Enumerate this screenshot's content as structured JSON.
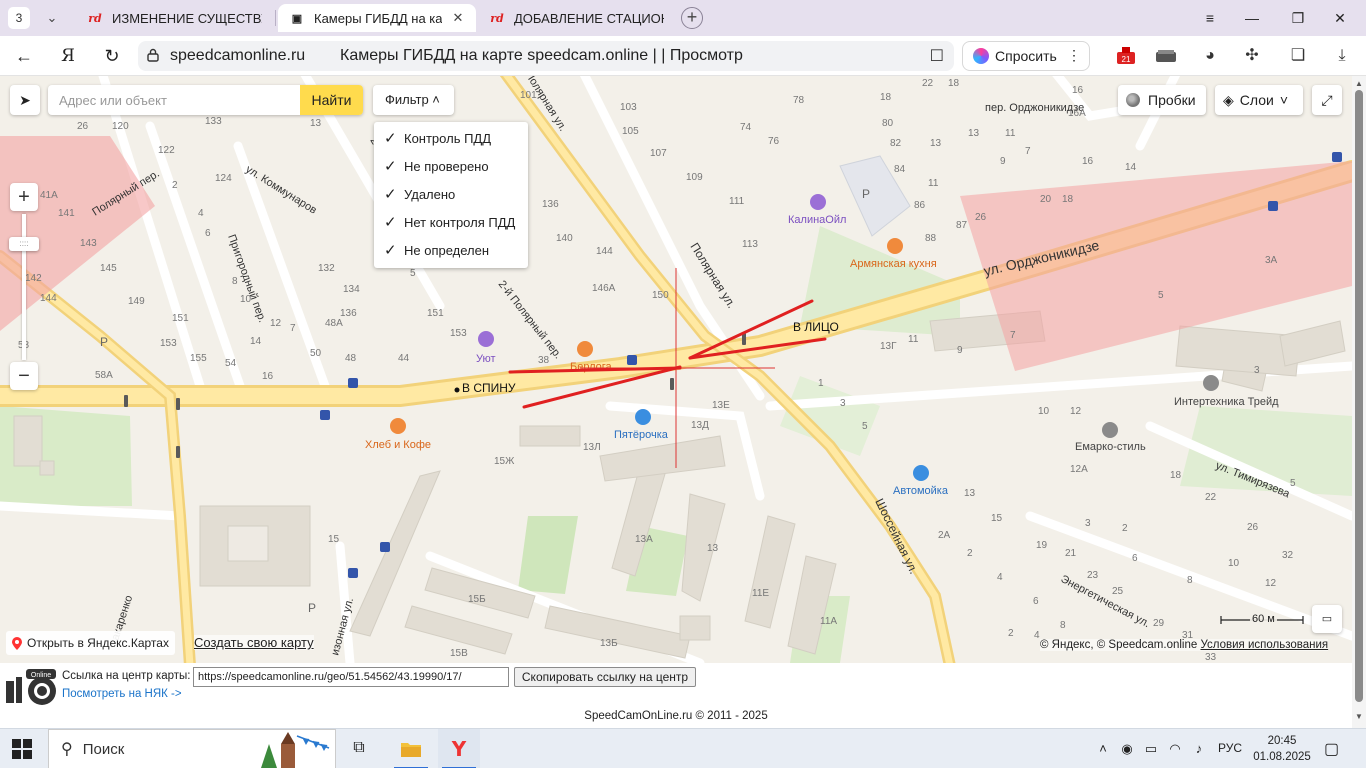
{
  "browser": {
    "tab_count": "3",
    "tabs": [
      {
        "title": "ИЗМЕНЕНИЕ СУЩЕСТВУ",
        "favicon": "rd",
        "active": false
      },
      {
        "title": "Камеры ГИБДД на карт",
        "favicon": "camera",
        "active": true
      },
      {
        "title": "ДОБАВЛЕНИЕ СТАЦИОН",
        "favicon": "rd",
        "active": false
      }
    ],
    "domain": "speedcamonline.ru",
    "page_title": "Камеры ГИБДД на карте speedcam.online | | Просмотр",
    "ask_label": "Спросить",
    "ext_badge": "21"
  },
  "map": {
    "search_placeholder": "Адрес или объект",
    "find_label": "Найти",
    "filter_label": "Фильтр",
    "filter_items": [
      "Контроль ПДД",
      "Не проверено",
      "Удалено",
      "Нет контроля ПДД",
      "Не определен"
    ],
    "traffic_label": "Пробки",
    "layers_label": "Слои",
    "open_yandex_label": "Открыть в Яндекс.Картах",
    "create_map_label": "Создать свою карту",
    "scale_label": "60 м",
    "copyright": "© Яндекс, © Speedcam.online",
    "terms_label": "Условия использования",
    "annotation_front": "В ЛИЦО",
    "annotation_back": "В СПИНУ",
    "streets": {
      "ordzhonikidze": "ул. Орджоникидзе",
      "pereulok_ordzhonikidze": "пер. Орджоникидзе",
      "polyarnaya": "Полярная ул.",
      "polyarnaya_top": "Полярная ул.",
      "vtoroy_polyarny": "2-й Полярный пер.",
      "vtoroy_top": "2-й",
      "polyarny_per": "Полярный пер.",
      "kommunarov": "ул. Коммунаров",
      "prigorodny": "Пригородный пер.",
      "shosseynaya": "Шоссейная ул.",
      "timiryazeva": "ул. Тимирязева",
      "energeticheskaya": "Энергетическая ул.",
      "makarenko": "акаренко",
      "izonnaya": "изонная ул."
    },
    "pois": {
      "kalinaoil": "КалинаОйл",
      "armenian": "Армянская кухня",
      "uyut": "Уют",
      "bread": "Хлеб и Кофе",
      "pyaterochka": "Пятёрочка",
      "avtomoyka": "Автомойка",
      "intertechnika": "Интертехника Трейд",
      "emarko": "Емарко-стиль",
      "beer": "Берлога"
    }
  },
  "page": {
    "link_label": "Ссылка на центр карты:",
    "link_value": "https://speedcamonline.ru/geo/51.54562/43.19990/17/",
    "copy_label": "Скопировать ссылку на центр",
    "nyak_label": "Посмотреть на НЯК ->",
    "footer": "SpeedCamOnLine.ru © 2011 - 2025"
  },
  "taskbar": {
    "search_label": "Поиск",
    "lang": "РУС",
    "time": "20:45",
    "date": "01.08.2025"
  }
}
